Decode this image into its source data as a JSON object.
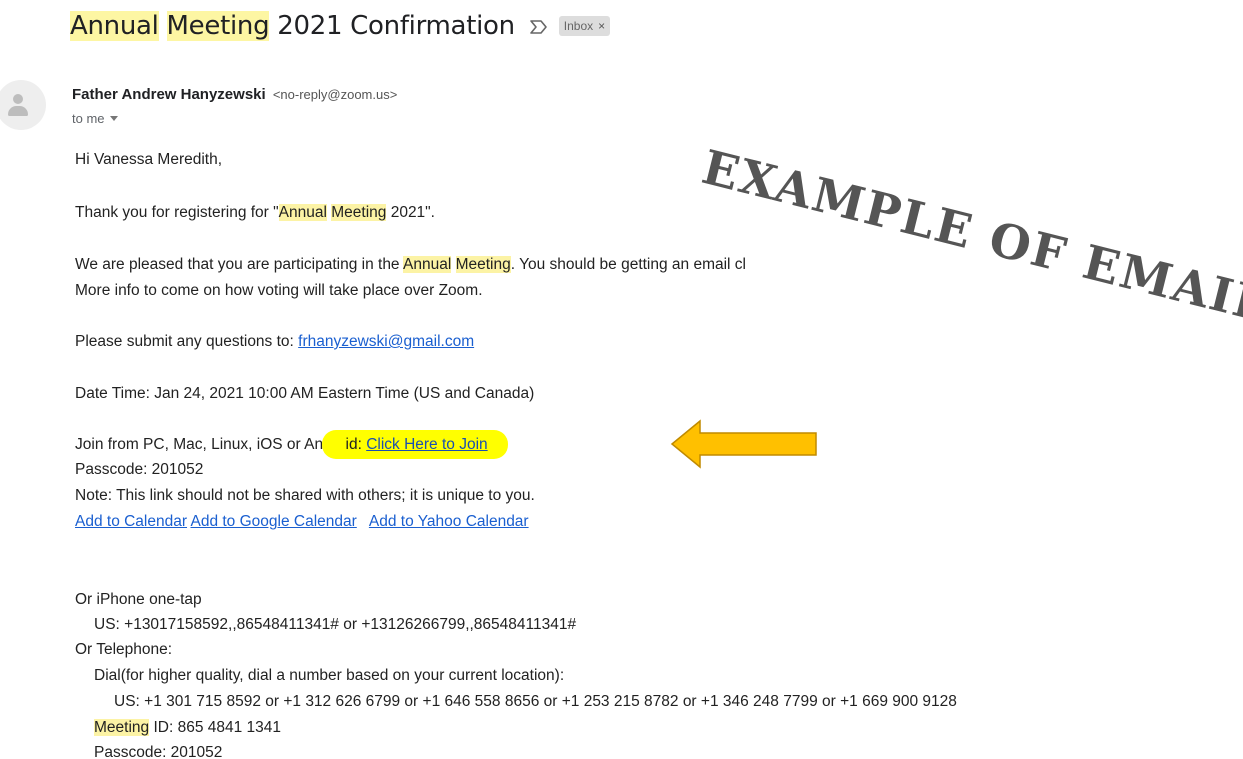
{
  "subject": {
    "part1": "Annual",
    "space1": " ",
    "part2": "Meeting",
    "part3": " 2021 Confirmation",
    "label_chip": "Inbox",
    "chip_close": "×"
  },
  "sender": {
    "name": "Father Andrew Hanyzewski",
    "email": "<no-reply@zoom.us>",
    "to": "to me"
  },
  "body": {
    "greeting": "Hi Vanessa Meredith,",
    "thanks_prefix": "Thank you for registering for \"",
    "thanks_hl1": "Annual",
    "thanks_hl2": "Meeting",
    "thanks_suffix": " 2021\".",
    "pleased_prefix": "We are pleased that you are participating in the ",
    "pleased_hl1": "Annual",
    "pleased_hl2": "Meeting",
    "pleased_suffix": ". You should be getting an email cl",
    "more_info": "More info to come on how voting will take place over Zoom.",
    "questions_prefix": "Please submit any questions to: ",
    "questions_email": "frhanyzewski@gmail.com",
    "datetime": "Date Time: Jan 24, 2021 10:00 AM Eastern Time (US and Canada)",
    "join_prefix": "Join from PC, Mac, Linux, iOS or Andro",
    "join_hl_text": "id: ",
    "join_link": "Click Here to Join",
    "passcode1": "Passcode: 201052",
    "note": "Note: This link should not be shared with others; it is unique to you.",
    "cal_link1": "Add to Calendar",
    "cal_link2": "Add to Google Calendar",
    "cal_link3": "Add to Yahoo Calendar",
    "iphone_heading": "Or iPhone one-tap",
    "iphone_us": "US: +13017158592,,86548411341# or +13126266799,,86548411341#",
    "telephone_heading": "Or Telephone:",
    "dial_heading": "Dial(for higher quality, dial a number based on your current location):",
    "dial_us": "US: +1 301 715 8592 or +1 312 626 6799 or +1 646 558 8656 or +1 253 215 8782 or +1 346 248 7799 or +1 669 900 9128",
    "meeting_id_hl": "Meeting",
    "meeting_id_suffix": " ID: 865 4841 1341",
    "passcode2": "Passcode: 201052"
  },
  "overlay": {
    "stamp_text": "EXAMPLE OF EMAIL",
    "arrow_color": "#ffc000",
    "arrow_outline": "#c08a00"
  },
  "icons": {
    "important": "important-marker-icon",
    "avatar": "default-avatar-icon",
    "dropdown": "caret-down-icon"
  }
}
